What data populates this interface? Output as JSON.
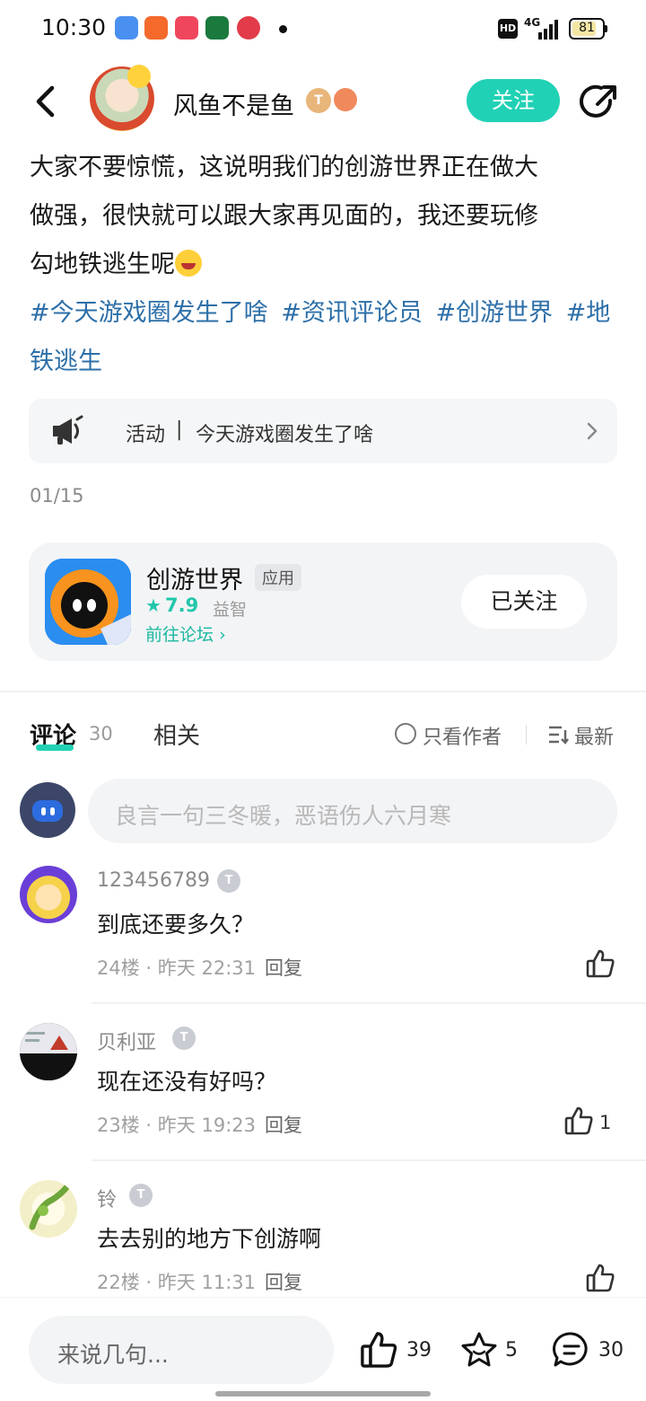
{
  "status_bar": {
    "time": "10:30",
    "network": "4G",
    "hd": "HD",
    "battery": "81",
    "battery_level": 0.81,
    "notification_icons": [
      "blue-app-icon",
      "orange-app-icon",
      "red-video-icon",
      "oppo-icon",
      "red-618-icon"
    ]
  },
  "header": {
    "author_name": "风鱼不是鱼",
    "level_badge": "T",
    "follow_label": "关注"
  },
  "post": {
    "lines": [
      "大家不要惊慌，这说明我们的创游世界正在做大",
      "做强，很快就可以跟大家再见面的，我还要玩修",
      "勾地铁逃生呢"
    ],
    "hashtags": [
      "#今天游戏圈发生了啥",
      "#资讯评论员",
      "#创游世界",
      "#地铁逃生"
    ],
    "activity": {
      "label": "活动",
      "separator": "|",
      "title": "今天游戏圈发生了啥"
    },
    "page_indicator": "01/15"
  },
  "game_card": {
    "name": "创游世界",
    "type_tag": "应用",
    "score": "7.9",
    "genre": "益智",
    "forum_link": "前往论坛",
    "followed_label": "已关注"
  },
  "comments_section": {
    "tab_comments": "评论",
    "comment_count": "30",
    "tab_related": "相关",
    "author_only": "只看作者",
    "sort": "最新",
    "input_placeholder": "良言一句三冬暖，恶语伤人六月寒"
  },
  "comments": [
    {
      "user": "123456789",
      "text": "到底还要多久？",
      "floor": "24楼",
      "sep": "·",
      "time": "昨天 22:31",
      "reply": "回复",
      "likes": ""
    },
    {
      "user": "贝利亚",
      "text": "现在还没有好吗？",
      "floor": "23楼",
      "sep": "·",
      "time": "昨天 19:23",
      "reply": "回复",
      "likes": "1"
    },
    {
      "user": "铃",
      "text": "去去别的地方下创游啊",
      "floor": "22楼",
      "sep": "·",
      "time": "昨天 11:31",
      "reply": "回复",
      "likes": ""
    }
  ],
  "bottom_bar": {
    "input_label": "来说几句...",
    "likes": "39",
    "favorites": "5",
    "comments": "30"
  },
  "colors": {
    "accent": "#21d1b5",
    "hashtag": "#2d6fa8",
    "score": "#21c7ab"
  }
}
